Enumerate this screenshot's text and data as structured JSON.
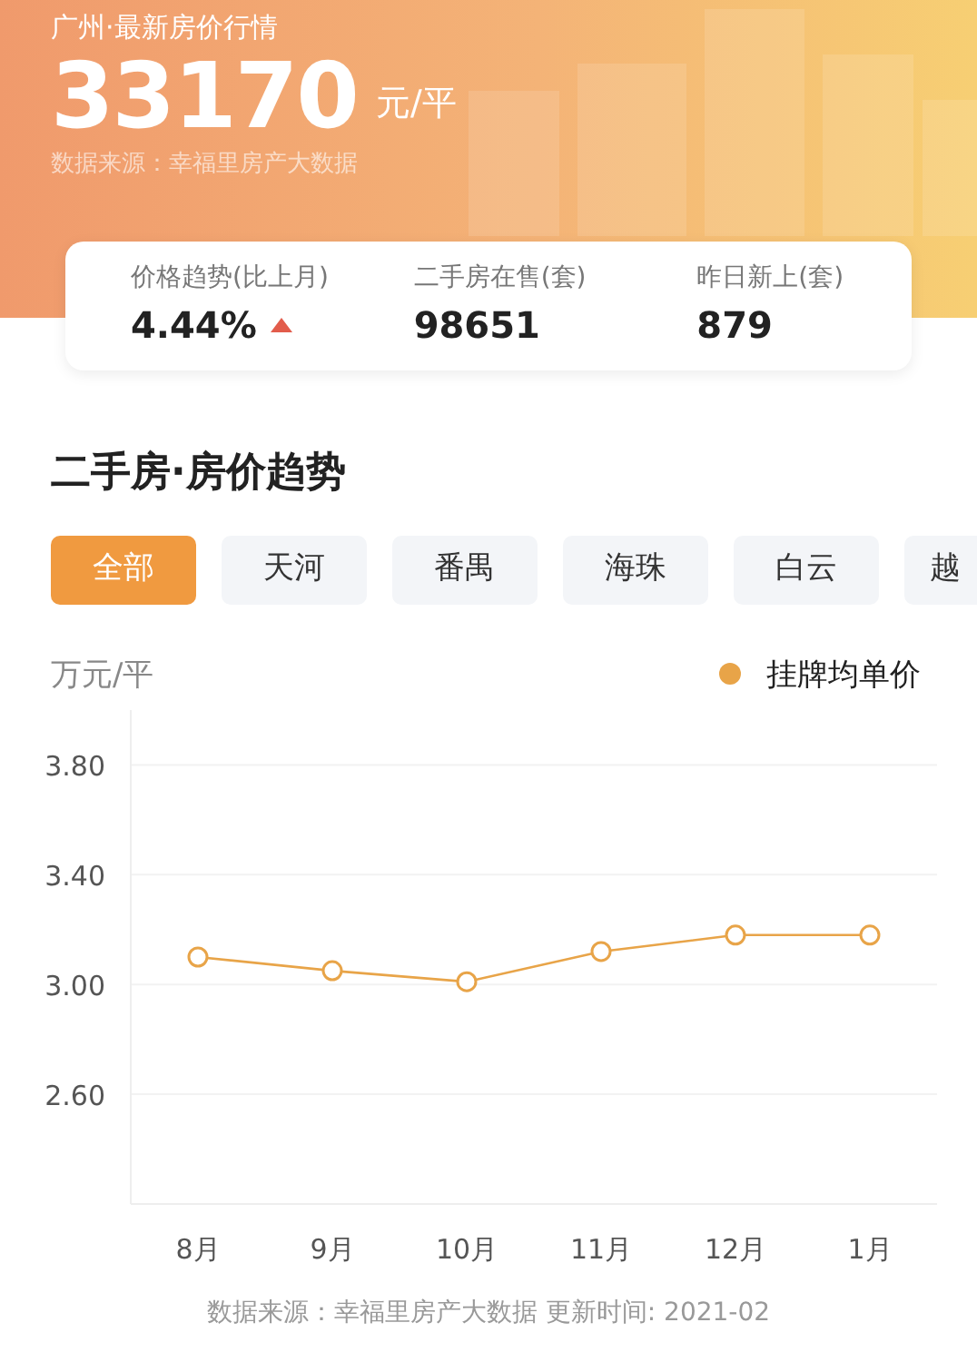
{
  "header": {
    "title": "广州·最新房价行情",
    "price": "33170",
    "unit": "元/平",
    "source": "数据来源：幸福里房产大数据"
  },
  "stats": [
    {
      "label": "价格趋势(比上月)",
      "value": "4.44%",
      "rising": true
    },
    {
      "label": "二手房在售(套)",
      "value": "98651"
    },
    {
      "label": "昨日新上(套)",
      "value": "879"
    }
  ],
  "section_title": "二手房·房价趋势",
  "tabs": [
    {
      "label": "全部",
      "selected": true
    },
    {
      "label": "天河",
      "selected": false
    },
    {
      "label": "番禺",
      "selected": false
    },
    {
      "label": "海珠",
      "selected": false
    },
    {
      "label": "白云",
      "selected": false
    },
    {
      "label": "越",
      "selected": false
    }
  ],
  "chart": {
    "chart_data": {
      "type": "line",
      "ylabel": "万元/平",
      "categories": [
        "8月",
        "9月",
        "10月",
        "11月",
        "12月",
        "1月"
      ],
      "series": [
        {
          "name": "挂牌均单价",
          "color": "#e8a448",
          "marker": "circle",
          "values": [
            3.1,
            3.05,
            3.01,
            3.12,
            3.18,
            3.18
          ]
        }
      ],
      "ylim": [
        2.2,
        4.0
      ],
      "grid": true,
      "yticks": [
        {
          "value": 2.6,
          "label": "2.60"
        },
        {
          "value": 3.0,
          "label": "3.00"
        },
        {
          "value": 3.4,
          "label": "3.40"
        },
        {
          "value": 3.8,
          "label": "3.80"
        }
      ]
    }
  },
  "footer": "数据来源：幸福里房产大数据 更新时间: 2021-02"
}
